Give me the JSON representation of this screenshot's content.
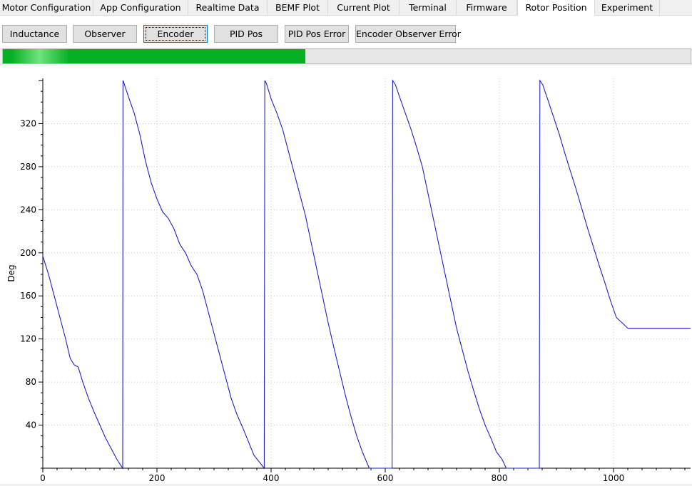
{
  "tabs": [
    {
      "label": "Motor Configuration",
      "active": false
    },
    {
      "label": "App Configuration",
      "active": false
    },
    {
      "label": "Realtime Data",
      "active": false
    },
    {
      "label": "BEMF Plot",
      "active": false
    },
    {
      "label": "Current Plot",
      "active": false
    },
    {
      "label": "Terminal",
      "active": false
    },
    {
      "label": "Firmware",
      "active": false
    },
    {
      "label": "Rotor Position",
      "active": true
    },
    {
      "label": "Experiment",
      "active": false
    }
  ],
  "buttons": [
    {
      "label": "Inductance"
    },
    {
      "label": "Observer"
    },
    {
      "label": "Encoder",
      "focused": true
    },
    {
      "label": "PID Pos"
    },
    {
      "label": "PID Pos Error"
    },
    {
      "label": "Encoder Observer Error"
    }
  ],
  "progress": {
    "fraction": 0.44,
    "color": "#06b025"
  },
  "chart_data": {
    "type": "line",
    "title": "",
    "xlabel": "",
    "ylabel": "Deg",
    "xlim": [
      0,
      1135
    ],
    "ylim": [
      0,
      362
    ],
    "x_ticks": [
      0,
      200,
      400,
      600,
      800,
      1000
    ],
    "y_ticks": [
      40,
      80,
      120,
      160,
      200,
      240,
      280,
      320
    ],
    "grid": true,
    "series": [
      {
        "color": "#2020c8",
        "points": [
          [
            0,
            197
          ],
          [
            10,
            180
          ],
          [
            20,
            160
          ],
          [
            30,
            140
          ],
          [
            40,
            120
          ],
          [
            48,
            102
          ],
          [
            55,
            96
          ],
          [
            62,
            94
          ],
          [
            70,
            80
          ],
          [
            80,
            65
          ],
          [
            90,
            52
          ],
          [
            100,
            40
          ],
          [
            110,
            28
          ],
          [
            120,
            18
          ],
          [
            130,
            8
          ],
          [
            140,
            0
          ],
          [
            140.5,
            360
          ],
          [
            142,
            358
          ],
          [
            150,
            345
          ],
          [
            160,
            330
          ],
          [
            170,
            310
          ],
          [
            180,
            285
          ],
          [
            190,
            265
          ],
          [
            200,
            250
          ],
          [
            210,
            238
          ],
          [
            220,
            232
          ],
          [
            230,
            222
          ],
          [
            240,
            208
          ],
          [
            250,
            200
          ],
          [
            260,
            188
          ],
          [
            270,
            180
          ],
          [
            280,
            165
          ],
          [
            290,
            145
          ],
          [
            300,
            125
          ],
          [
            310,
            105
          ],
          [
            320,
            85
          ],
          [
            330,
            65
          ],
          [
            340,
            50
          ],
          [
            350,
            38
          ],
          [
            360,
            25
          ],
          [
            370,
            12
          ],
          [
            388,
            0
          ],
          [
            389,
            360
          ],
          [
            392,
            357
          ],
          [
            400,
            343
          ],
          [
            410,
            330
          ],
          [
            420,
            315
          ],
          [
            430,
            295
          ],
          [
            440,
            275
          ],
          [
            450,
            255
          ],
          [
            460,
            235
          ],
          [
            470,
            210
          ],
          [
            480,
            185
          ],
          [
            490,
            160
          ],
          [
            500,
            135
          ],
          [
            510,
            112
          ],
          [
            520,
            90
          ],
          [
            530,
            68
          ],
          [
            540,
            48
          ],
          [
            550,
            30
          ],
          [
            560,
            15
          ],
          [
            572,
            0
          ],
          [
            612,
            0
          ],
          [
            613,
            360
          ],
          [
            618,
            356
          ],
          [
            625,
            345
          ],
          [
            635,
            330
          ],
          [
            645,
            315
          ],
          [
            655,
            298
          ],
          [
            665,
            280
          ],
          [
            675,
            255
          ],
          [
            685,
            230
          ],
          [
            695,
            205
          ],
          [
            705,
            180
          ],
          [
            715,
            155
          ],
          [
            725,
            130
          ],
          [
            735,
            110
          ],
          [
            745,
            90
          ],
          [
            755,
            72
          ],
          [
            765,
            55
          ],
          [
            775,
            40
          ],
          [
            785,
            28
          ],
          [
            795,
            15
          ],
          [
            805,
            8
          ],
          [
            812,
            0
          ],
          [
            870,
            0
          ],
          [
            871,
            360
          ],
          [
            876,
            356
          ],
          [
            885,
            342
          ],
          [
            895,
            326
          ],
          [
            905,
            310
          ],
          [
            915,
            292
          ],
          [
            925,
            275
          ],
          [
            935,
            258
          ],
          [
            945,
            240
          ],
          [
            955,
            222
          ],
          [
            965,
            205
          ],
          [
            975,
            188
          ],
          [
            985,
            172
          ],
          [
            995,
            155
          ],
          [
            1005,
            140
          ],
          [
            1015,
            135
          ],
          [
            1025,
            130
          ],
          [
            1035,
            130
          ],
          [
            1050,
            130
          ],
          [
            1060,
            130
          ],
          [
            1080,
            130
          ],
          [
            1100,
            130
          ],
          [
            1120,
            130
          ],
          [
            1135,
            130
          ]
        ]
      }
    ]
  }
}
